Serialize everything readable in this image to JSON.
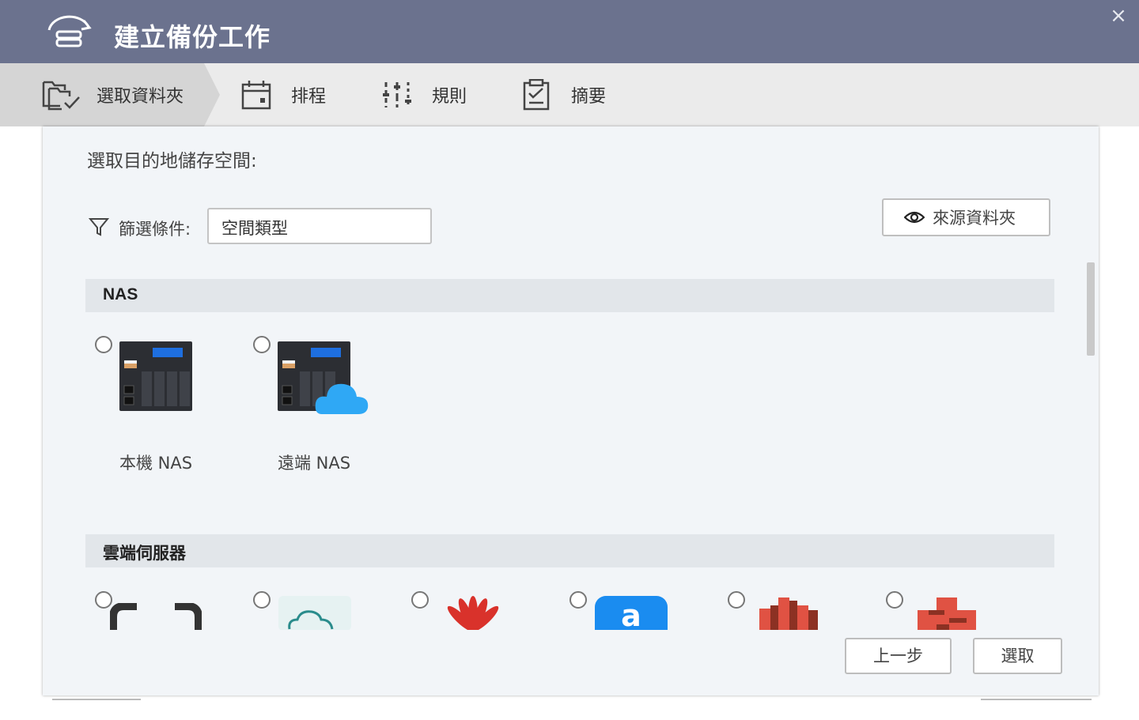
{
  "window": {
    "title": "建立備份工作",
    "close_label": "×"
  },
  "steps": [
    {
      "label": "選取資料夾",
      "icon": "folder-check-icon",
      "active": true
    },
    {
      "label": "排程",
      "icon": "calendar-icon",
      "active": false
    },
    {
      "label": "規則",
      "icon": "sliders-icon",
      "active": false
    },
    {
      "label": "摘要",
      "icon": "clipboard-check-icon",
      "active": false
    }
  ],
  "main": {
    "heading": "選取目的地儲存空間:",
    "filter": {
      "label": "篩選條件:",
      "value": "空間類型"
    },
    "source_button": {
      "label": "來源資料夾",
      "icon": "eye-icon"
    }
  },
  "sections": [
    {
      "title": "NAS",
      "items": [
        {
          "label": "本機 NAS",
          "icon": "nas-icon"
        },
        {
          "label": "遠端 NAS",
          "icon": "remote-nas-icon"
        }
      ]
    },
    {
      "title": "雲端伺服器",
      "items": [
        {
          "icon": "alibaba-cloud-icon"
        },
        {
          "icon": "cloud-storage-icon"
        },
        {
          "icon": "huawei-cloud-icon"
        },
        {
          "icon": "amazon-drive-icon"
        },
        {
          "icon": "amazon-s3-icon"
        },
        {
          "icon": "amazon-glacier-icon"
        }
      ]
    }
  ],
  "footer": {
    "back_label": "上一步",
    "select_label": "選取"
  },
  "colors": {
    "titlebar": "#6b728e",
    "step_active": "#d5d5d5",
    "panel": "#f2f5f8",
    "section_bar": "#e2e6ea"
  }
}
